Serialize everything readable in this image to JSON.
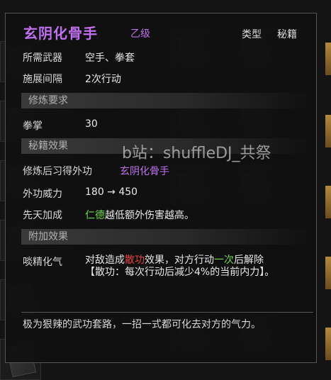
{
  "item": {
    "name": "玄阴化骨手",
    "grade": "乙级",
    "type_label": "类型",
    "type_value": "秘籍"
  },
  "requirements": [
    {
      "label": "所需武器",
      "value": "空手、拳套"
    },
    {
      "label": "施展间隔",
      "value": "2次行动"
    }
  ],
  "sections": {
    "training_req": "修炼要求",
    "book_effect": "秘籍效果",
    "extra_effect": "附加效果"
  },
  "training": {
    "label": "拳掌",
    "value": "30"
  },
  "effects": {
    "unlock_label": "修炼后习得外功",
    "unlock_value": "玄阴化骨手",
    "power_label": "外功威力",
    "power_value": "180 → 450",
    "innate_label": "先天加成",
    "innate_trait": "仁德",
    "innate_text": "越低额外伤害越高。"
  },
  "extra": {
    "name": "啖精化气",
    "p1": "对敌造成",
    "keyword": "散功",
    "p2": "效果，对方行动",
    "count": "一次",
    "p3": "后解除",
    "p4": "【散功：每次行动后减少4%的当前内力】。"
  },
  "flavor": "极为狠辣的武功套路，一招一式都可化去对方的气力。",
  "watermark": "b站：shuffleDJ_共祭",
  "colors": {
    "title": "#c070f0",
    "trait": "#6fdc4a",
    "keyword": "#e84040"
  }
}
